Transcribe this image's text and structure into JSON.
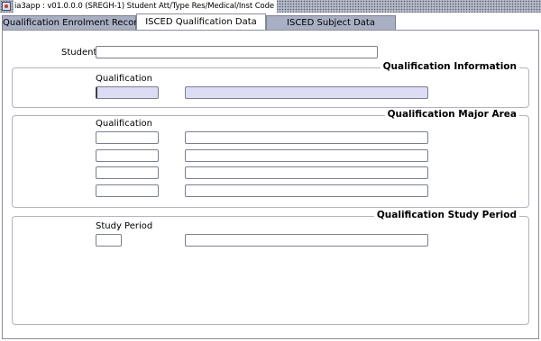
{
  "window": {
    "title": "ia3app : v01.0.0.0 (SREGH-1) Student Att/Type Res/Medical/Inst Code",
    "icon": "app-icon"
  },
  "tabs": [
    {
      "label": "Qualification Enrolment Record",
      "active": false
    },
    {
      "label": "ISCED Qualification Data",
      "active": true
    },
    {
      "label": "ISCED Subject Data",
      "active": false
    }
  ],
  "student": {
    "label": "Student",
    "value": ""
  },
  "qualification_information": {
    "title": "Qualification Information",
    "qualification_label": "Qualification",
    "code": "",
    "description": ""
  },
  "qualification_major_area": {
    "title": "Qualification Major Area",
    "qualification_label": "Qualification",
    "rows": [
      {
        "code": "",
        "description": ""
      },
      {
        "code": "",
        "description": ""
      },
      {
        "code": "",
        "description": ""
      },
      {
        "code": "",
        "description": ""
      }
    ]
  },
  "qualification_study_period": {
    "title": "Qualification Study Period",
    "study_period_label": "Study Period",
    "code": "",
    "description": ""
  },
  "colors": {
    "tab_inactive": "#a9b0c4",
    "field_shaded": "#dcdcf4",
    "titlebar": "#b8bcc8"
  }
}
